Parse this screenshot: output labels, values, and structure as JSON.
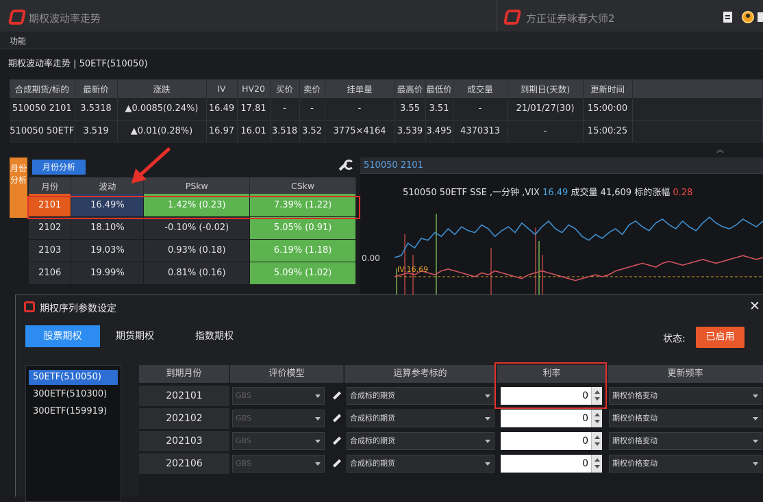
{
  "window": {
    "title": "期权波动率走势",
    "second_title": "方正证券咏春大师2"
  },
  "menu": {
    "label": "功能"
  },
  "breadcrumb": "期权波动率走势 | 50ETF(510050)",
  "quote_table": {
    "headers": [
      "合成期货/标的",
      "最新价",
      "涨跌",
      "IV",
      "HV20",
      "买价",
      "卖价",
      "挂单量",
      "最高价",
      "最低价",
      "成交量",
      "到期日(天数)",
      "更新时间"
    ],
    "rows": [
      [
        "510050 2101",
        "3.5318",
        "▲0.0085(0.24%)",
        "16.49",
        "17.81",
        "-",
        "-",
        "-",
        "3.55",
        "3.51",
        "-",
        "21/01/27(30)",
        "15:00:00"
      ],
      [
        "510050 50ETF",
        "3.519",
        "▲0.01(0.28%)",
        "16.97",
        "16.01",
        "3.518",
        "3.52",
        "3775×4164",
        "3.539",
        "3.495",
        "4370313",
        "-",
        "15:00:25"
      ]
    ]
  },
  "side_tab": {
    "label": "月份分析"
  },
  "month_panel": {
    "button": "月份分析",
    "headers": [
      "月份",
      "波动",
      "PSkw",
      "CSkw"
    ],
    "rows": [
      [
        "2101",
        "16.49%",
        "1.42% (0.23)",
        "7.39% (1.22)"
      ],
      [
        "2102",
        "18.10%",
        "-0.10% (-0.02)",
        "5.05% (0.91)"
      ],
      [
        "2103",
        "19.03%",
        "0.93% (0.18)",
        "6.19% (1.18)"
      ],
      [
        "2106",
        "19.99%",
        "0.81% (0.16)",
        "5.09% (1.02)"
      ]
    ]
  },
  "chart_panel": {
    "tab": "510050 2101",
    "info_prefix": "510050 50ETF SSE ,一分钟 ,VIX",
    "vix": "16.49",
    "volume_label": "成交量 41,609 标的涨幅",
    "change": "0.28",
    "y_tick": "0.00",
    "iv_label": "IV:16.69"
  },
  "dialog": {
    "title": "期权序列参数设定",
    "tabs": [
      "股票期权",
      "期货期权",
      "指数期权"
    ],
    "status_label": "状态:",
    "status_value": "已启用",
    "underlyings": [
      "50ETF(510050)",
      "300ETF(510300)",
      "300ETF(159919)"
    ],
    "headers": [
      "到期月份",
      "评价模型",
      "运算参考标的",
      "利率",
      "更新频率"
    ],
    "rows": [
      {
        "month": "202101",
        "model": "GBS",
        "ref": "合成标的期货",
        "rate": "0",
        "freq": "期权价格变动"
      },
      {
        "month": "202102",
        "model": "GBS",
        "ref": "合成标的期货",
        "rate": "0",
        "freq": "期权价格变动"
      },
      {
        "month": "202103",
        "model": "GBS",
        "ref": "合成标的期货",
        "rate": "0",
        "freq": "期权价格变动"
      },
      {
        "month": "202106",
        "model": "GBS",
        "ref": "合成标的期货",
        "rate": "0",
        "freq": "期权价格变动"
      }
    ]
  },
  "colors": {
    "accent": "#2c8cf0",
    "status": "#e8582a",
    "up": "#ef4a4a",
    "down": "#58d05b",
    "highlight_box": "#e0312a"
  },
  "chart_data": {
    "type": "line",
    "title": "",
    "xlabel": "",
    "ylabel": "",
    "series": [
      {
        "values": [
          40,
          42,
          55,
          50,
          60,
          58,
          66,
          62,
          70,
          64,
          72,
          68,
          66,
          74,
          70,
          62,
          68,
          72,
          66,
          76,
          70,
          64,
          72,
          78,
          70,
          66,
          74,
          70,
          62,
          58,
          64,
          60,
          66,
          70,
          64,
          74,
          78,
          72,
          68,
          76,
          80,
          74,
          70,
          78,
          72,
          68,
          76,
          82,
          76,
          72,
          70,
          74,
          80,
          76,
          72,
          78
        ]
      },
      {
        "values": [
          20,
          22,
          24,
          22,
          26,
          24,
          22,
          26,
          28,
          26,
          24,
          22,
          20,
          24,
          22,
          26,
          24,
          22,
          20,
          18,
          22,
          24,
          26,
          24,
          22,
          20,
          18,
          16,
          18,
          20,
          22,
          20,
          22,
          26,
          28,
          30,
          32,
          34,
          32,
          30,
          34,
          36,
          34,
          32,
          34,
          36,
          38,
          36,
          34,
          36,
          38,
          40,
          42,
          40,
          38,
          40
        ]
      }
    ]
  }
}
